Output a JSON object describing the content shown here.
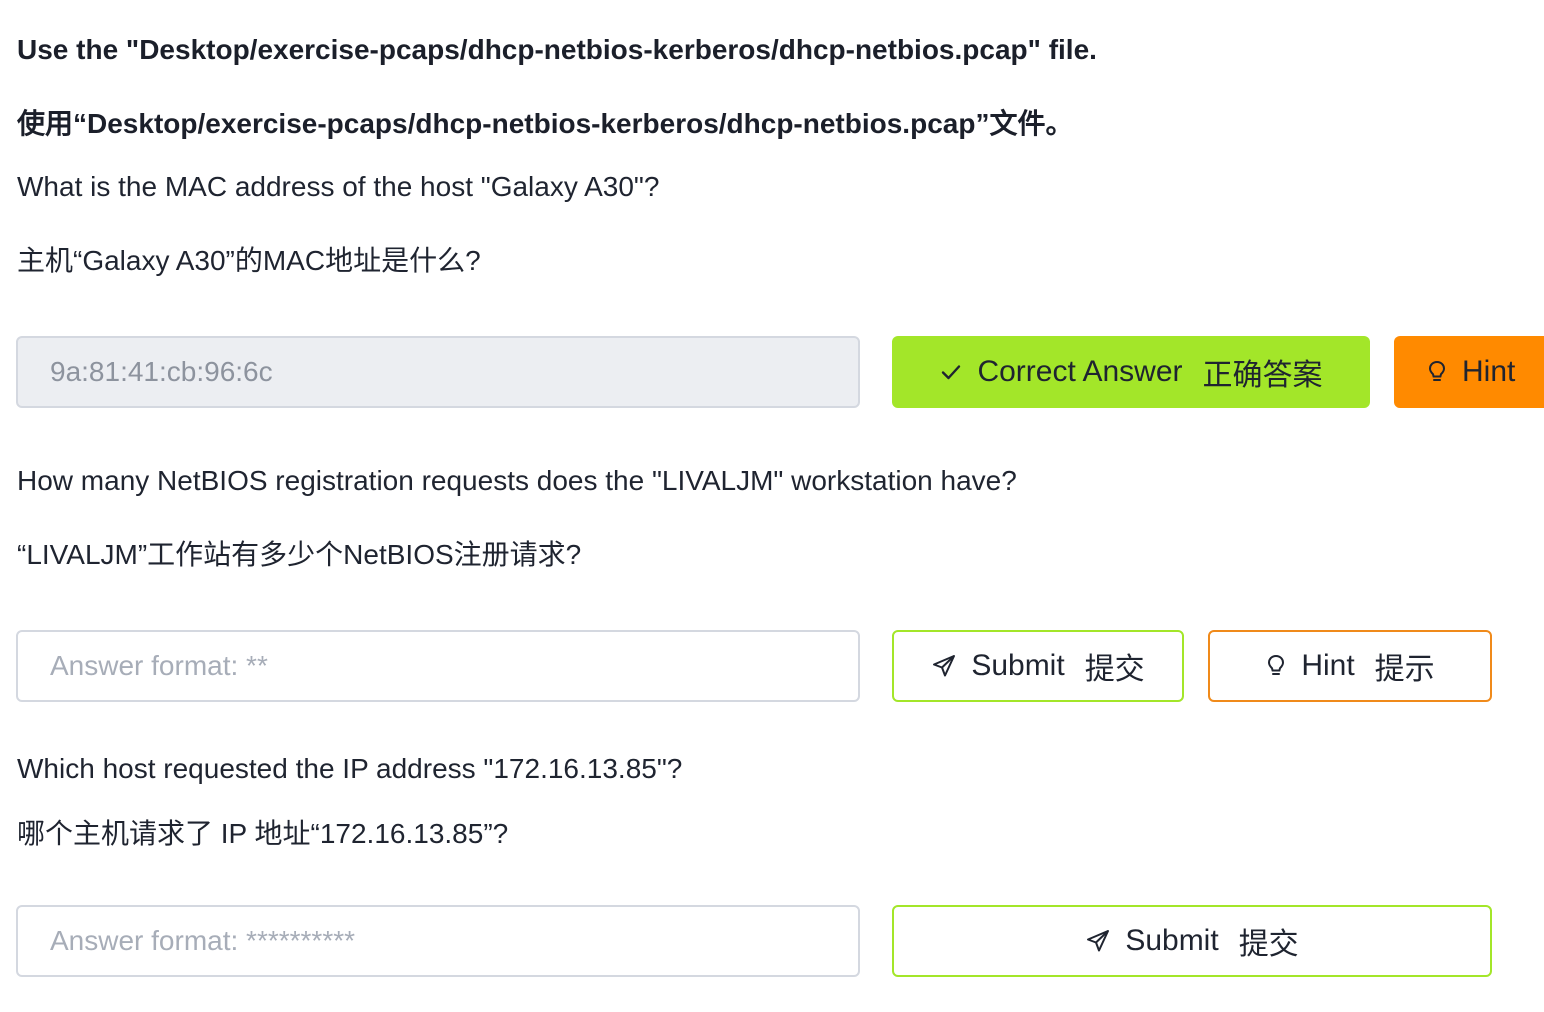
{
  "instructions": {
    "file_en": "Use the \"Desktop/exercise-pcaps/dhcp-netbios-kerberos/dhcp-netbios.pcap\" file.",
    "file_zh": "使用“Desktop/exercise-pcaps/dhcp-netbios-kerberos/dhcp-netbios.pcap”文件。"
  },
  "questions": [
    {
      "text_en": "What is the MAC address of the host \"Galaxy A30\"?",
      "text_zh": "主机“Galaxy A30”的MAC地址是什么?",
      "answer_value": "9a:81:41:cb:96:6c",
      "status_button": {
        "label_en": "Correct Answer",
        "label_zh": "正确答案",
        "icon": "check-icon"
      },
      "hint_button": {
        "label_en": "Hint",
        "icon": "lightbulb-icon"
      }
    },
    {
      "text_en": "How many NetBIOS registration requests does the \"LIVALJM\" workstation have?",
      "text_zh": "“LIVALJM”工作站有多少个NetBIOS注册请求?",
      "placeholder": "Answer format: **",
      "submit_button": {
        "label_en": "Submit",
        "label_zh": "提交",
        "icon": "send-icon"
      },
      "hint_button": {
        "label_en": "Hint",
        "label_zh": "提示",
        "icon": "lightbulb-icon"
      }
    },
    {
      "text_en": "Which host requested the IP address \"172.16.13.85\"?",
      "text_zh": "哪个主机请求了 IP 地址“172.16.13.85”?",
      "placeholder": "Answer format: **********",
      "submit_button": {
        "label_en": "Submit",
        "label_zh": "提交",
        "icon": "send-icon"
      }
    }
  ],
  "colors": {
    "correct": "#a3e629",
    "hint": "#ff8a00",
    "text": "#1f2430",
    "placeholder": "#a7adb8",
    "input_border": "#d4d8e0",
    "readonly_bg": "#eceef2"
  }
}
